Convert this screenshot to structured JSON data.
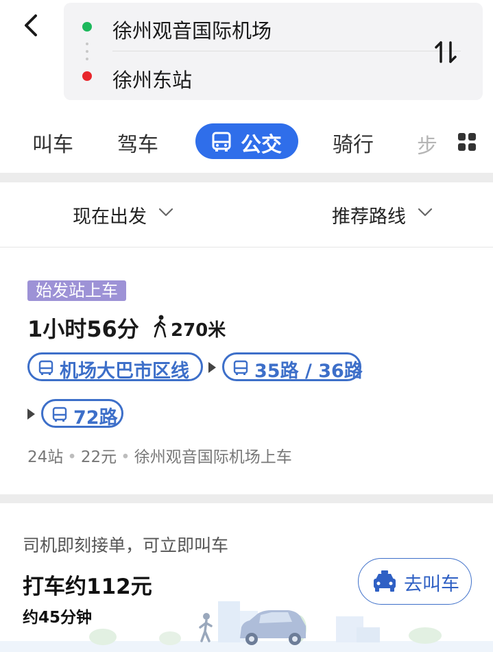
{
  "route": {
    "from": "徐州观音国际机场",
    "to": "徐州东站"
  },
  "modes": {
    "taxi": "叫车",
    "drive": "驾车",
    "bus": "公交",
    "bike": "骑行",
    "walk": "步"
  },
  "filters": {
    "time": "现在出发",
    "sort": "推荐路线"
  },
  "plan": {
    "tag": "始发站上车",
    "duration": "1小时56分",
    "walk_distance": "270米",
    "lines": [
      "机场大巴市区线",
      "35路 / 36路",
      "72路"
    ],
    "stops": "24站",
    "fare": "22元",
    "board": "徐州观音国际机场上车"
  },
  "taxi_card": {
    "note": "司机即刻接单，可立即叫车",
    "price": "打车约112元",
    "time": "约45分钟",
    "button": "去叫车"
  },
  "icons": [
    "back-arrow-icon",
    "swap-icon",
    "bus-icon",
    "grid-icon",
    "walk-icon",
    "taxi-icon",
    "chevron-down-icon"
  ],
  "colors": {
    "accent": "#2f6eea",
    "line_pill": "#3d6fc9",
    "tag_bg": "#9d92d6",
    "origin": "#1db85c",
    "destination": "#e8262c"
  }
}
